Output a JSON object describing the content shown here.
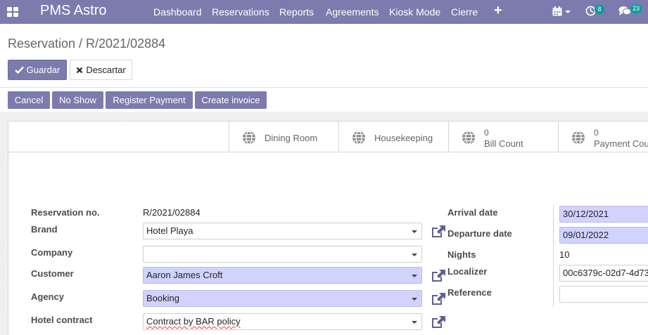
{
  "navbar": {
    "brand": "PMS Astro",
    "menu": [
      "Dashboard",
      "Reservations",
      "Reports",
      "Agreements",
      "Kiosk Mode",
      "Cierre"
    ],
    "plus_label": "+",
    "activity_count": "8",
    "messages_count": "23",
    "icons": [
      "apps-icon",
      "calendar-icon",
      "clock-icon",
      "chat-icon"
    ]
  },
  "breadcrumb": "Reservation / R/2021/02884",
  "actions": {
    "save": "Guardar",
    "discard": "Descartar"
  },
  "status_buttons": [
    "Cancel",
    "No Show",
    "Register Payment",
    "Create invoice"
  ],
  "smart_buttons": [
    {
      "label": "Dining Room"
    },
    {
      "label": "Housekeeping"
    },
    {
      "count": "0",
      "label": "Bill Count"
    },
    {
      "count": "0",
      "label": "Payment Cou"
    }
  ],
  "form": {
    "left": {
      "reservation_no": {
        "label": "Reservation no.",
        "value": "R/2021/02884"
      },
      "brand": {
        "label": "Brand",
        "value": "Hotel Playa"
      },
      "company": {
        "label": "Company",
        "value": ""
      },
      "customer": {
        "label": "Customer",
        "value": "Aaron James Croft"
      },
      "agency": {
        "label": "Agency",
        "value": "Booking"
      },
      "hotel_contract": {
        "label": "Hotel contract",
        "value": "Contract by BAR policy"
      }
    },
    "right": {
      "arrival": {
        "label": "Arrival date",
        "value": "30/12/2021"
      },
      "departure": {
        "label": "Departure date",
        "value": "09/01/2022"
      },
      "nights": {
        "label": "Nights",
        "value": "10"
      },
      "localizer": {
        "label": "Localizer",
        "value": "00c6379c-02d7-4d73"
      },
      "reference": {
        "label": "Reference",
        "value": ""
      }
    }
  },
  "colors": {
    "primary": "#7c7bad",
    "required_field": "#d2d2ff",
    "badge": "#00a09d"
  }
}
